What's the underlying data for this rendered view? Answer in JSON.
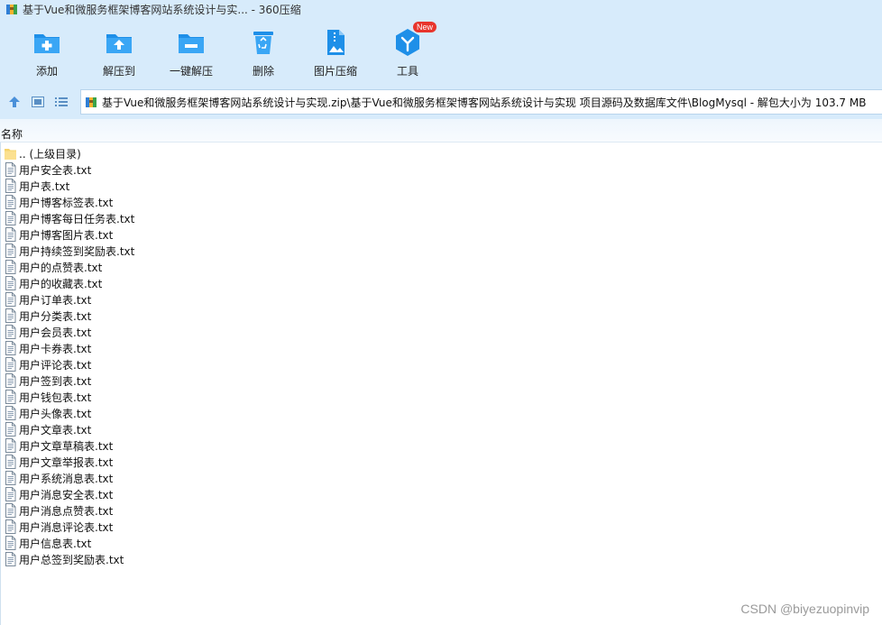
{
  "window": {
    "title": "基于Vue和微服务框架博客网站系统设计与实... - 360压缩"
  },
  "toolbar": {
    "items": [
      {
        "label": "添加",
        "icon": "add-icon"
      },
      {
        "label": "解压到",
        "icon": "extract-to-icon"
      },
      {
        "label": "一键解压",
        "icon": "one-click-extract-icon"
      },
      {
        "label": "删除",
        "icon": "delete-icon"
      },
      {
        "label": "图片压缩",
        "icon": "image-compress-icon"
      },
      {
        "label": "工具",
        "icon": "tools-icon",
        "badge": "New"
      }
    ]
  },
  "addressbar": {
    "path": "基于Vue和微服务框架博客网站系统设计与实现.zip\\基于Vue和微服务框架博客网站系统设计与实现 项目源码及数据库文件\\BlogMysql - 解包大小为 103.7 MB"
  },
  "columns": {
    "name": "名称"
  },
  "files": [
    {
      "name": ".. (上级目录)",
      "type": "folder"
    },
    {
      "name": "用户安全表.txt",
      "type": "txt"
    },
    {
      "name": "用户表.txt",
      "type": "txt"
    },
    {
      "name": "用户博客标签表.txt",
      "type": "txt"
    },
    {
      "name": "用户博客每日任务表.txt",
      "type": "txt"
    },
    {
      "name": "用户博客图片表.txt",
      "type": "txt"
    },
    {
      "name": "用户持续签到奖励表.txt",
      "type": "txt"
    },
    {
      "name": "用户的点赞表.txt",
      "type": "txt"
    },
    {
      "name": "用户的收藏表.txt",
      "type": "txt"
    },
    {
      "name": "用户订单表.txt",
      "type": "txt"
    },
    {
      "name": "用户分类表.txt",
      "type": "txt"
    },
    {
      "name": "用户会员表.txt",
      "type": "txt"
    },
    {
      "name": "用户卡券表.txt",
      "type": "txt"
    },
    {
      "name": "用户评论表.txt",
      "type": "txt"
    },
    {
      "name": "用户签到表.txt",
      "type": "txt"
    },
    {
      "name": "用户钱包表.txt",
      "type": "txt"
    },
    {
      "name": "用户头像表.txt",
      "type": "txt"
    },
    {
      "name": "用户文章表.txt",
      "type": "txt"
    },
    {
      "name": "用户文章草稿表.txt",
      "type": "txt"
    },
    {
      "name": "用户文章举报表.txt",
      "type": "txt"
    },
    {
      "name": "用户系统消息表.txt",
      "type": "txt"
    },
    {
      "name": "用户消息安全表.txt",
      "type": "txt"
    },
    {
      "name": "用户消息点赞表.txt",
      "type": "txt"
    },
    {
      "name": "用户消息评论表.txt",
      "type": "txt"
    },
    {
      "name": "用户信息表.txt",
      "type": "txt"
    },
    {
      "name": "用户总签到奖励表.txt",
      "type": "txt"
    }
  ],
  "watermark": "CSDN @biyezuopinvip",
  "colors": {
    "toolbar_bg": "#d7ebfb",
    "icon_blue": "#1e8fe8",
    "badge_red": "#e8352c",
    "folder_yellow": "#f6d36b"
  }
}
